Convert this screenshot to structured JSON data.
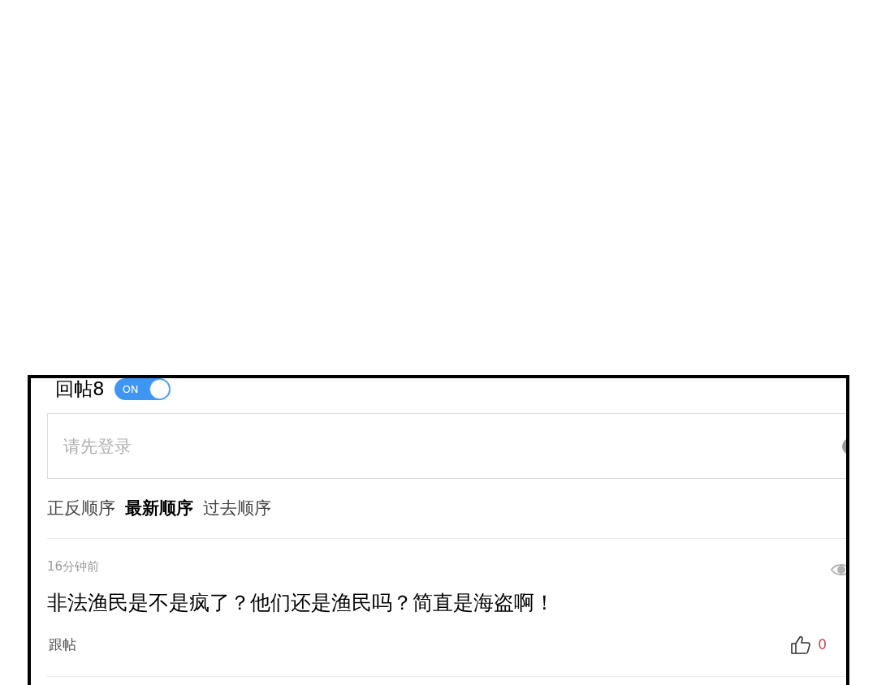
{
  "replies": {
    "label": "回帖8",
    "toggle": {
      "label": "ON",
      "on": true
    }
  },
  "comment_box": {
    "placeholder": "请先登录"
  },
  "sort_tabs": [
    {
      "label": "正反顺序",
      "selected": false
    },
    {
      "label": "最新顺序",
      "selected": true
    },
    {
      "label": "过去顺序",
      "selected": false
    }
  ],
  "comments": [
    {
      "time": "16分钟前",
      "text": "非法渔民是不是疯了？他们还是渔民吗？简直是海盗啊！",
      "reply": "跟帖",
      "likes": "0"
    }
  ]
}
